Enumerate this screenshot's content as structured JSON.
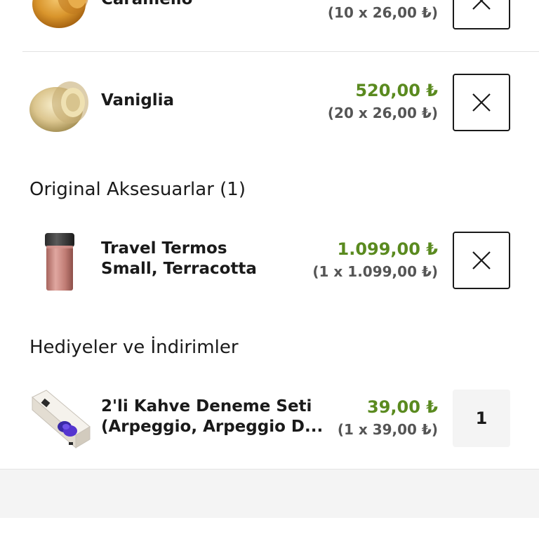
{
  "colors": {
    "price_green": "#5a8a1f",
    "text": "#1a1a1a",
    "muted": "#555555"
  },
  "coffee_items": [
    {
      "name": "Caramello",
      "unit_price": "(10 x 26,00 ₺)",
      "icon": "capsule-caramello-icon"
    },
    {
      "name": "Vaniglia",
      "price": "520,00 ₺",
      "unit_price": "(20 x 26,00 ₺)",
      "icon": "capsule-vaniglia-icon"
    }
  ],
  "accessories": {
    "title": "Original Aksesuarlar (1)",
    "items": [
      {
        "name_line1": "Travel Termos",
        "name_line2": "Small, Terracotta",
        "price": "1.099,00 ₺",
        "unit_price": "(1 x 1.099,00 ₺)",
        "icon": "travel-mug-icon"
      }
    ]
  },
  "gifts": {
    "title": "Hediyeler ve İndirimler",
    "items": [
      {
        "name_line1": "2'li Kahve Deneme Seti",
        "name_line2": "(Arpeggio, Arpeggio D...",
        "price": "39,00 ₺",
        "unit_price": "(1 x 39,00 ₺)",
        "quantity": "1",
        "icon": "gift-box-icon"
      }
    ]
  }
}
